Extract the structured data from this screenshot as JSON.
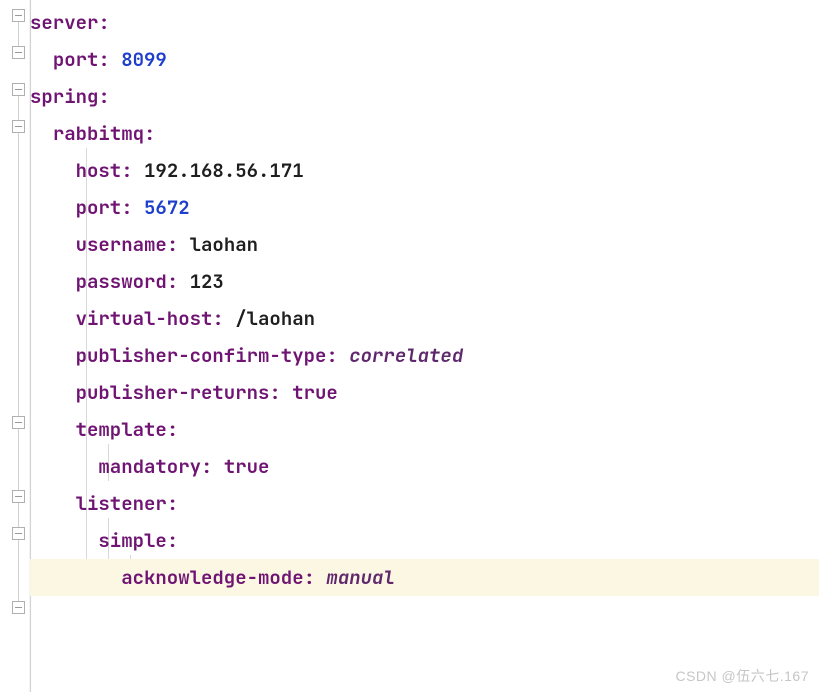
{
  "yaml": {
    "server_key": "server",
    "server_port_key": "port",
    "server_port_val": "8099",
    "spring_key": "spring",
    "rabbitmq_key": "rabbitmq",
    "host_key": "host",
    "host_val": "192.168.56.171",
    "rmq_port_key": "port",
    "rmq_port_val": "5672",
    "username_key": "username",
    "username_val": "laohan",
    "password_key": "password",
    "password_val": "123",
    "vhost_key": "virtual-host",
    "vhost_val": "/laohan",
    "pct_key": "publisher-confirm-type",
    "pct_val": "correlated",
    "pr_key": "publisher-returns",
    "pr_val": "true",
    "template_key": "template",
    "mandatory_key": "mandatory",
    "mandatory_val": "true",
    "listener_key": "listener",
    "simple_key": "simple",
    "ack_key": "acknowledge-mode",
    "ack_val": "manual"
  },
  "watermark": "CSDN @伍六七.167"
}
